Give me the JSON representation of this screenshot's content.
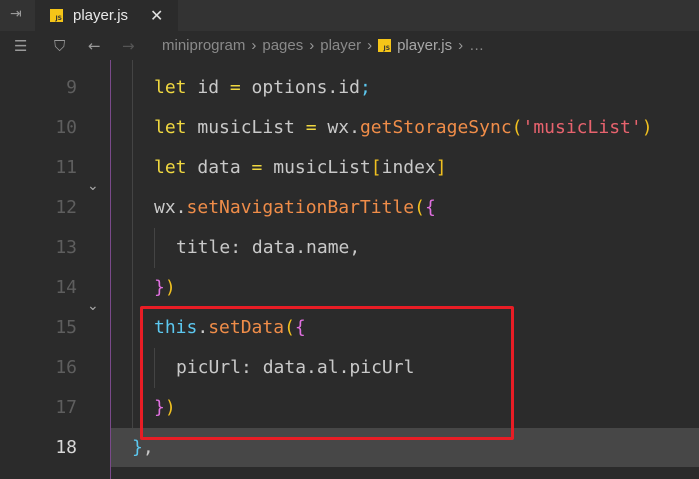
{
  "tab": {
    "icon": "js-file-icon",
    "icon_text": "JS",
    "label": "player.js",
    "close": "✕"
  },
  "breadcrumb": {
    "items": [
      "miniprogram",
      "pages",
      "player"
    ],
    "file": "player.js",
    "more": "…",
    "sep": "›"
  },
  "highlight_color": "#e81d25",
  "lines": [
    {
      "n": "9",
      "indent": 1,
      "tokens": [
        [
          "let",
          "kw"
        ],
        [
          " id ",
          "id"
        ],
        [
          "=",
          "op"
        ],
        [
          " options.id",
          "id"
        ],
        [
          ";",
          "bl"
        ]
      ]
    },
    {
      "n": "10",
      "indent": 1,
      "tokens": [
        [
          "let",
          "kw"
        ],
        [
          " musicList ",
          "id"
        ],
        [
          "=",
          "op"
        ],
        [
          " wx.",
          "id"
        ],
        [
          "getStorageSync",
          "fn"
        ],
        [
          "(",
          "b2"
        ],
        [
          "'musicList'",
          "str"
        ],
        [
          ")",
          "b2"
        ]
      ]
    },
    {
      "n": "11",
      "indent": 1,
      "tokens": [
        [
          "let",
          "kw"
        ],
        [
          " data ",
          "id"
        ],
        [
          "=",
          "op"
        ],
        [
          " musicList",
          "id"
        ],
        [
          "[",
          "b2"
        ],
        [
          "index",
          "id"
        ],
        [
          "]",
          "b2"
        ]
      ]
    },
    {
      "n": "12",
      "indent": 1,
      "fold": true,
      "tokens": [
        [
          "wx.",
          "id"
        ],
        [
          "setNavigationBarTitle",
          "fn"
        ],
        [
          "(",
          "b2"
        ],
        [
          "{",
          "b1"
        ]
      ]
    },
    {
      "n": "13",
      "indent": 2,
      "tokens": [
        [
          "title",
          "id"
        ],
        [
          ": data.name,",
          "id"
        ]
      ]
    },
    {
      "n": "14",
      "indent": 1,
      "tokens": [
        [
          "}",
          "b1"
        ],
        [
          ")",
          "b2"
        ]
      ]
    },
    {
      "n": "15",
      "indent": 1,
      "fold": true,
      "tokens": [
        [
          "this",
          "this"
        ],
        [
          ".",
          "id"
        ],
        [
          "setData",
          "fn"
        ],
        [
          "(",
          "b2"
        ],
        [
          "{",
          "b1"
        ]
      ]
    },
    {
      "n": "16",
      "indent": 2,
      "tokens": [
        [
          "picUrl",
          "id"
        ],
        [
          ": data.al.picUrl",
          "id"
        ]
      ]
    },
    {
      "n": "17",
      "indent": 1,
      "tokens": [
        [
          "}",
          "b1"
        ],
        [
          ")",
          "b2"
        ]
      ]
    },
    {
      "n": "18",
      "indent": 0,
      "current": true,
      "tokens": [
        [
          "}",
          "bl"
        ],
        [
          ",",
          "id"
        ]
      ]
    }
  ]
}
